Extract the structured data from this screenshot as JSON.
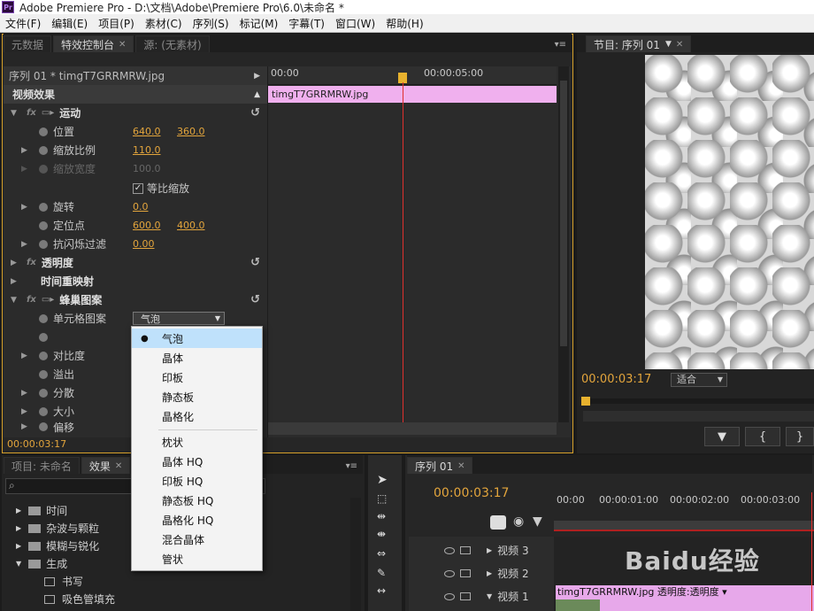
{
  "titlebar": {
    "logo": "Pr",
    "title": "Adobe Premiere Pro - D:\\文档\\Adobe\\Premiere Pro\\6.0\\未命名 *"
  },
  "menu": [
    "文件(F)",
    "编辑(E)",
    "项目(P)",
    "素材(C)",
    "序列(S)",
    "标记(M)",
    "字幕(T)",
    "窗口(W)",
    "帮助(H)"
  ],
  "ec_panel": {
    "tabs": [
      "元数据",
      "特效控制台",
      "源: (无素材)"
    ],
    "sequence_clip": "序列 01 * timgT7GRRMRW.jpg",
    "section": "视频效果",
    "rows": {
      "motion": "运动",
      "position": "位置",
      "position_x": "640.0",
      "position_y": "360.0",
      "scale": "缩放比例",
      "scale_v": "110.0",
      "scale_w": "缩放宽度",
      "scale_w_v": "100.0",
      "uniform": "等比缩放",
      "rotation": "旋转",
      "rotation_v": "0.0",
      "anchor": "定位点",
      "anchor_x": "600.0",
      "anchor_y": "400.0",
      "antiflicker": "抗闪烁过滤",
      "antiflicker_v": "0.00",
      "opacity": "透明度",
      "timeremap": "时间重映射",
      "cellpattern": "蜂巢图案",
      "cellpattern_type": "单元格图案",
      "cellpattern_type_v": "气泡",
      "contrast": "对比度",
      "overflow": "溢出",
      "disperse": "分散",
      "size": "大小",
      "offset": "偏移"
    },
    "timecode": "00:00:03:17",
    "ruler": {
      "start": "00:00",
      "mid": "00:00:05:00"
    },
    "clip": "timgT7GRRMRW.jpg"
  },
  "dropdown": {
    "items_a": [
      "气泡",
      "晶体",
      "印板",
      "静态板",
      "晶格化"
    ],
    "items_b": [
      "枕状",
      "晶体 HQ",
      "印板 HQ",
      "静态板 HQ",
      "晶格化 HQ",
      "混合晶体",
      "管状"
    ]
  },
  "program": {
    "tab": "节目: 序列 01",
    "timecode": "00:00:03:17",
    "fit": "适合"
  },
  "project": {
    "tabs": [
      "项目: 未命名",
      "效果"
    ],
    "tree": [
      "时间",
      "杂波与颗粒",
      "模糊与锐化",
      "生成",
      "书写",
      "吸色管填充"
    ]
  },
  "timeline": {
    "tab": "序列 01",
    "timecode": "00:00:03:17",
    "ruler": [
      "00:00",
      "00:00:01:00",
      "00:00:02:00",
      "00:00:03:00"
    ],
    "tracks": [
      "视频 3",
      "视频 2",
      "视频 1"
    ],
    "clip_label": "timgT7GRRMRW.jpg 透明度:透明度 ▾"
  },
  "watermark": "Baidu经验"
}
